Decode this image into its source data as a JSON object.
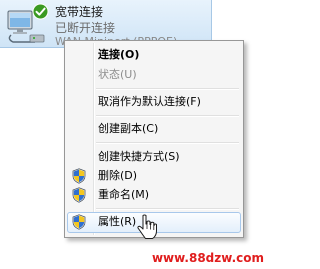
{
  "connection": {
    "name": "宽带连接",
    "status": "已断开连接",
    "device": "WAN Miniport (PPPOE)",
    "state_icon": "check-icon"
  },
  "menu": {
    "items": [
      {
        "label": "连接(O)",
        "default": true
      },
      {
        "label": "状态(U)",
        "disabled": true
      },
      {
        "label": "取消作为默认连接(F)"
      },
      {
        "label": "创建副本(C)"
      },
      {
        "label": "创建快捷方式(S)"
      },
      {
        "label": "删除(D)",
        "icon": "shield-icon"
      },
      {
        "label": "重命名(M)",
        "icon": "shield-icon"
      },
      {
        "label": "属性(R)",
        "icon": "shield-icon",
        "highlighted": true
      }
    ]
  },
  "watermark": "www.88dzw.com",
  "colors": {
    "menu_background": "#f5f5f5",
    "highlight_border": "#a8c8eb",
    "watermark": "#e01e1e",
    "status_ok": "#3a9a22"
  }
}
